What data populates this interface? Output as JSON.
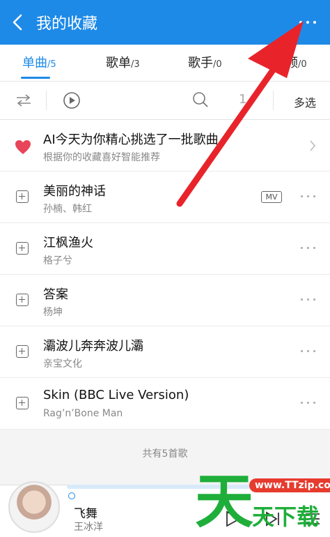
{
  "header": {
    "title": "我的收藏"
  },
  "tabs": [
    {
      "label": "单曲",
      "count": "/5",
      "active": true
    },
    {
      "label": "歌单",
      "count": "/3"
    },
    {
      "label": "歌手",
      "count": "/0"
    },
    {
      "label": "频",
      "count": "/0"
    }
  ],
  "toolbar": {
    "multi_select": "多选",
    "partial_digit": "1"
  },
  "recommend": {
    "title": "AI今天为你精心挑选了一批歌曲",
    "subtitle": "根据你的收藏喜好智能推荐"
  },
  "songs": [
    {
      "name": "美丽的神话",
      "artist": "孙楠、韩红",
      "badge": "MV"
    },
    {
      "name": "江枫渔火",
      "artist": "格子兮"
    },
    {
      "name": "答案",
      "artist": "杨坤"
    },
    {
      "name": "灞波儿奔奔波儿灞",
      "artist": "亲宝文化"
    },
    {
      "name": "Skin (BBC Live Version)",
      "artist": "Rag’n’Bone Man"
    }
  ],
  "footer": {
    "total": "共有5首歌"
  },
  "player": {
    "title": "飞舞",
    "artist": "王冰洋"
  },
  "watermark": {
    "big": "天",
    "url": "www.TTzip.com",
    "small": "天下载"
  },
  "colors": {
    "accent": "#1e8ae8",
    "heart": "#e8455a",
    "arrow": "#e8242a",
    "watermark_green": "#1fae3a"
  }
}
